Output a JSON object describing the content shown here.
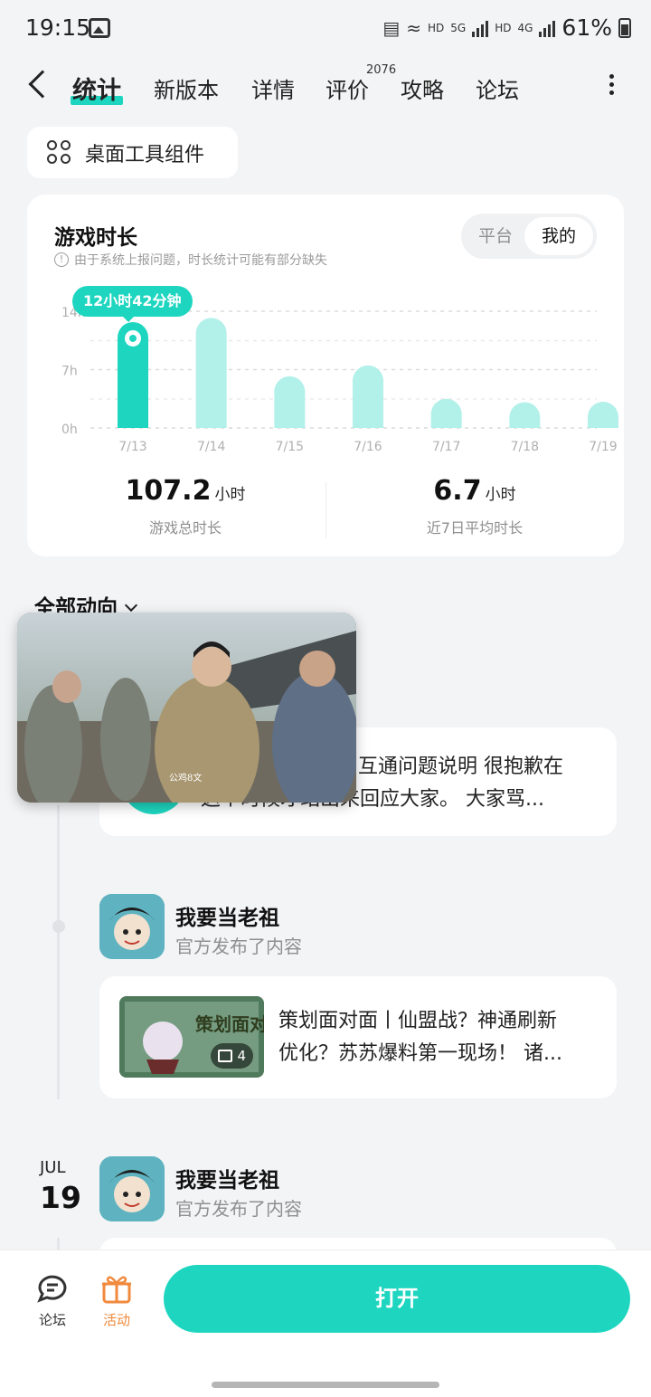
{
  "status": {
    "time": "19:15",
    "battery": "61%",
    "net_hd": "HD",
    "net_5g": "5G",
    "net_4g": "4G"
  },
  "tabs": [
    {
      "label": "统计"
    },
    {
      "label": "新版本"
    },
    {
      "label": "详情"
    },
    {
      "label": "评价"
    },
    {
      "label": "攻略"
    },
    {
      "label": "论坛"
    }
  ],
  "tab_badge": "2076",
  "widget_button": "桌面工具组件",
  "stats": {
    "title": "游戏时长",
    "note": "由于系统上报问题，时长统计可能有部分缺失",
    "segments": [
      "平台",
      "我的"
    ],
    "highlight": "12小时42分钟",
    "total_value": "107.2",
    "total_unit": "小时",
    "total_label": "游戏总时长",
    "avg_value": "6.7",
    "avg_unit": "小时",
    "avg_label": "近7日平均时长"
  },
  "chart_data": {
    "type": "bar",
    "categories": [
      "7/13",
      "7/14",
      "7/15",
      "7/16",
      "7/17",
      "7/18",
      "7/19"
    ],
    "values": [
      12.7,
      13.2,
      6.2,
      7.5,
      3.3,
      2.5,
      2.6
    ],
    "yticks": [
      "0h",
      "7h",
      "14h"
    ],
    "ylim": [
      0,
      14
    ],
    "highlight_index": 0,
    "colors": {
      "highlight": "#1ed6c0",
      "normal": "#b2f0ea"
    }
  },
  "feed": {
    "title": "全部动向",
    "post1_text_line1": "互通问题说明 很抱歉在",
    "post1_text_line2": "这个时候才站出来回应大家。 大家骂...",
    "post2_game": "我要当老祖",
    "post2_sub": "官方发布了内容",
    "post2_text_line1": "策划面对面丨仙盟战？神通刷新",
    "post2_text_line2": "优化？苏苏爆料第一现场！ 诸...",
    "post2_image_count": "4",
    "post2_thumb_title": "策划面对面",
    "date_month": "JUL",
    "date_day": "19",
    "post3_game": "我要当老祖",
    "post3_sub": "官方发布了内容"
  },
  "video_overlay": {
    "caption": "公鸡8文"
  },
  "bottom": {
    "forum": "论坛",
    "activity": "活动",
    "open": "打开"
  }
}
